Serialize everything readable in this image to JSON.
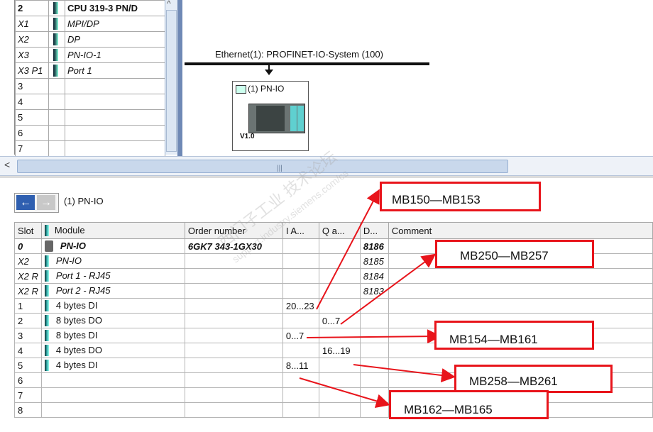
{
  "rack": {
    "rows": [
      {
        "slot": "2",
        "module": "CPU 319-3 PN/D"
      },
      {
        "slot": "X1",
        "module": "MPI/DP"
      },
      {
        "slot": "X2",
        "module": "DP"
      },
      {
        "slot": "X3",
        "module": "PN-IO-1"
      },
      {
        "slot": "X3 P1",
        "module": "Port 1"
      },
      {
        "slot": "3",
        "module": ""
      },
      {
        "slot": "4",
        "module": ""
      },
      {
        "slot": "5",
        "module": ""
      },
      {
        "slot": "6",
        "module": ""
      },
      {
        "slot": "7",
        "module": ""
      }
    ]
  },
  "network": {
    "bus_label": "Ethernet(1): PROFINET-IO-System (100)",
    "station_title": "(1) PN-IO",
    "station_version": "V1.0"
  },
  "detail": {
    "title": "(1)  PN-IO",
    "columns": [
      "Slot",
      "Module",
      "Order number",
      "I A...",
      "Q a...",
      "D...",
      "Comment"
    ],
    "rows": [
      {
        "slot": "0",
        "module": "PN-IO",
        "order": "6GK7 343-1GX30",
        "iaddr": "",
        "qaddr": "",
        "diag": "8186",
        "comment": ""
      },
      {
        "slot": "X2",
        "module": "PN-IO",
        "order": "",
        "iaddr": "",
        "qaddr": "",
        "diag": "8185",
        "comment": ""
      },
      {
        "slot": "X2 R",
        "module": "Port 1 - RJ45",
        "order": "",
        "iaddr": "",
        "qaddr": "",
        "diag": "8184",
        "comment": ""
      },
      {
        "slot": "X2 R",
        "module": "Port 2 - RJ45",
        "order": "",
        "iaddr": "",
        "qaddr": "",
        "diag": "8183",
        "comment": ""
      },
      {
        "slot": "1",
        "module": "4 bytes DI",
        "order": "",
        "iaddr": "20...23",
        "qaddr": "",
        "diag": "",
        "comment": ""
      },
      {
        "slot": "2",
        "module": "8 bytes DO",
        "order": "",
        "iaddr": "",
        "qaddr": "0...7",
        "diag": "",
        "comment": ""
      },
      {
        "slot": "3",
        "module": "8 bytes DI",
        "order": "",
        "iaddr": "0...7",
        "qaddr": "",
        "diag": "",
        "comment": ""
      },
      {
        "slot": "4",
        "module": "4 bytes DO",
        "order": "",
        "iaddr": "",
        "qaddr": "16...19",
        "diag": "",
        "comment": ""
      },
      {
        "slot": "5",
        "module": "4 bytes DI",
        "order": "",
        "iaddr": "8...11",
        "qaddr": "",
        "diag": "",
        "comment": ""
      },
      {
        "slot": "6",
        "module": "",
        "order": "",
        "iaddr": "",
        "qaddr": "",
        "diag": "",
        "comment": ""
      },
      {
        "slot": "7",
        "module": "",
        "order": "",
        "iaddr": "",
        "qaddr": "",
        "diag": "",
        "comment": ""
      },
      {
        "slot": "8",
        "module": "",
        "order": "",
        "iaddr": "",
        "qaddr": "",
        "diag": "",
        "comment": ""
      }
    ]
  },
  "annotations": [
    {
      "label": "MB150—MB153"
    },
    {
      "label": "MB250—MB257"
    },
    {
      "label": "MB154—MB161"
    },
    {
      "label": "MB258—MB261"
    },
    {
      "label": "MB162—MB165"
    }
  ],
  "watermark": {
    "cn": "西门子工业 技术论坛",
    "url": "support.industry.siemens.com/cs"
  },
  "colors": {
    "annotation_red": "#e8141b",
    "frame_blue": "#6f89b5",
    "module_teal": "#5fd0d0"
  }
}
